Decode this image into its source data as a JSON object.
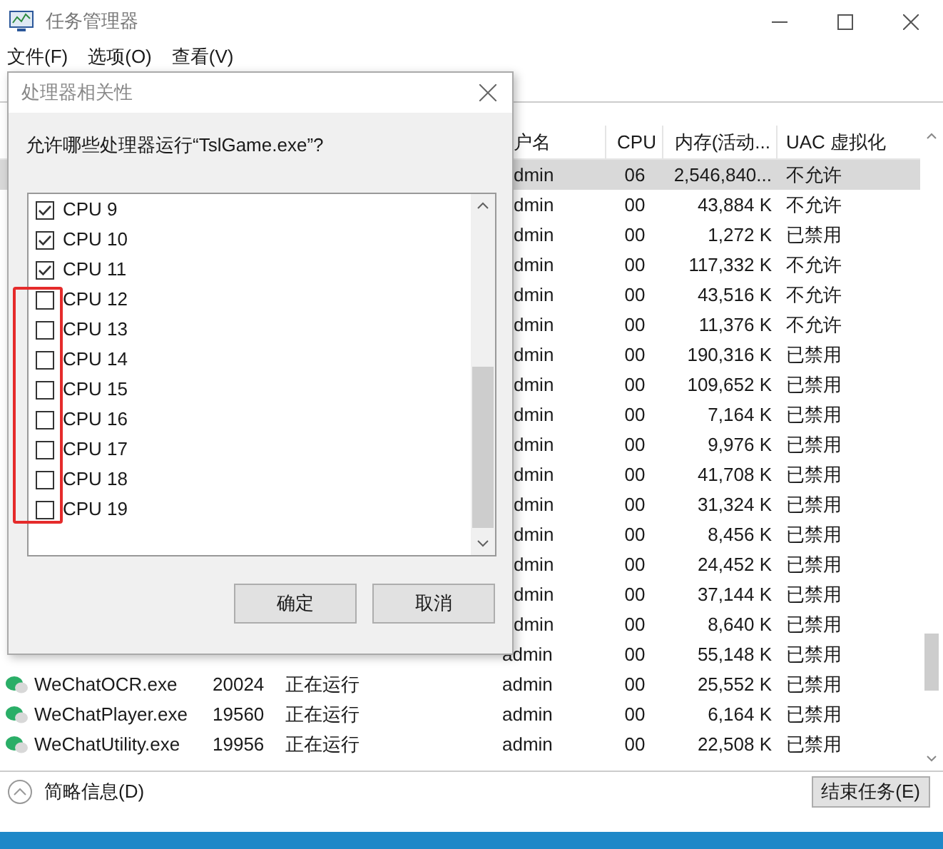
{
  "window": {
    "title": "任务管理器"
  },
  "menu": [
    "文件(F)",
    "选项(O)",
    "查看(V)"
  ],
  "table": {
    "columns": [
      "户名",
      "CPU",
      "内存(活动...",
      "UAC 虚拟化"
    ],
    "rows": [
      {
        "user": "dmin",
        "cpu": "06",
        "memory": "2,546,840...",
        "uac": "不允许",
        "selected": true
      },
      {
        "user": "dmin",
        "cpu": "00",
        "memory": "43,884 K",
        "uac": "不允许",
        "selected": false
      },
      {
        "user": "dmin",
        "cpu": "00",
        "memory": "1,272 K",
        "uac": "已禁用",
        "selected": false
      },
      {
        "user": "dmin",
        "cpu": "00",
        "memory": "117,332 K",
        "uac": "不允许",
        "selected": false
      },
      {
        "user": "dmin",
        "cpu": "00",
        "memory": "43,516 K",
        "uac": "不允许",
        "selected": false
      },
      {
        "user": "dmin",
        "cpu": "00",
        "memory": "11,376 K",
        "uac": "不允许",
        "selected": false
      },
      {
        "user": "dmin",
        "cpu": "00",
        "memory": "190,316 K",
        "uac": "已禁用",
        "selected": false
      },
      {
        "user": "dmin",
        "cpu": "00",
        "memory": "109,652 K",
        "uac": "已禁用",
        "selected": false
      },
      {
        "user": "dmin",
        "cpu": "00",
        "memory": "7,164 K",
        "uac": "已禁用",
        "selected": false
      },
      {
        "user": "dmin",
        "cpu": "00",
        "memory": "9,976 K",
        "uac": "已禁用",
        "selected": false
      },
      {
        "user": "dmin",
        "cpu": "00",
        "memory": "41,708 K",
        "uac": "已禁用",
        "selected": false
      },
      {
        "user": "dmin",
        "cpu": "00",
        "memory": "31,324 K",
        "uac": "已禁用",
        "selected": false
      },
      {
        "user": "dmin",
        "cpu": "00",
        "memory": "8,456 K",
        "uac": "已禁用",
        "selected": false
      },
      {
        "user": "dmin",
        "cpu": "00",
        "memory": "24,452 K",
        "uac": "已禁用",
        "selected": false
      },
      {
        "user": "dmin",
        "cpu": "00",
        "memory": "37,144 K",
        "uac": "已禁用",
        "selected": false
      },
      {
        "user": "dmin",
        "cpu": "00",
        "memory": "8,640 K",
        "uac": "已禁用",
        "selected": false
      },
      {
        "user": "admin",
        "cpu": "00",
        "memory": "55,148 K",
        "uac": "已禁用",
        "selected": false
      },
      {
        "kind": "wechat",
        "name": "WeChatOCR.exe",
        "pid": "20024",
        "status": "正在运行",
        "user": "admin",
        "cpu": "00",
        "memory": "25,552 K",
        "uac": "已禁用",
        "selected": false
      },
      {
        "kind": "wechat",
        "name": "WeChatPlayer.exe",
        "pid": "19560",
        "status": "正在运行",
        "user": "admin",
        "cpu": "00",
        "memory": "6,164 K",
        "uac": "已禁用",
        "selected": false
      },
      {
        "kind": "wechat",
        "name": "WeChatUtility.exe",
        "pid": "19956",
        "status": "正在运行",
        "user": "admin",
        "cpu": "00",
        "memory": "22,508 K",
        "uac": "已禁用",
        "selected": false
      }
    ]
  },
  "footer": {
    "details_toggle": "简略信息(D)",
    "end_task": "结束任务(E)"
  },
  "dialog": {
    "title": "处理器相关性",
    "question": "允许哪些处理器运行“TslGame.exe”?",
    "cpus": [
      {
        "label": "CPU 9",
        "checked": true
      },
      {
        "label": "CPU 10",
        "checked": true
      },
      {
        "label": "CPU 11",
        "checked": true
      },
      {
        "label": "CPU 12",
        "checked": false
      },
      {
        "label": "CPU 13",
        "checked": false
      },
      {
        "label": "CPU 14",
        "checked": false
      },
      {
        "label": "CPU 15",
        "checked": false
      },
      {
        "label": "CPU 16",
        "checked": false
      },
      {
        "label": "CPU 17",
        "checked": false
      },
      {
        "label": "CPU 18",
        "checked": false
      },
      {
        "label": "CPU 19",
        "checked": false
      }
    ],
    "buttons": [
      "确定",
      "取消"
    ]
  }
}
